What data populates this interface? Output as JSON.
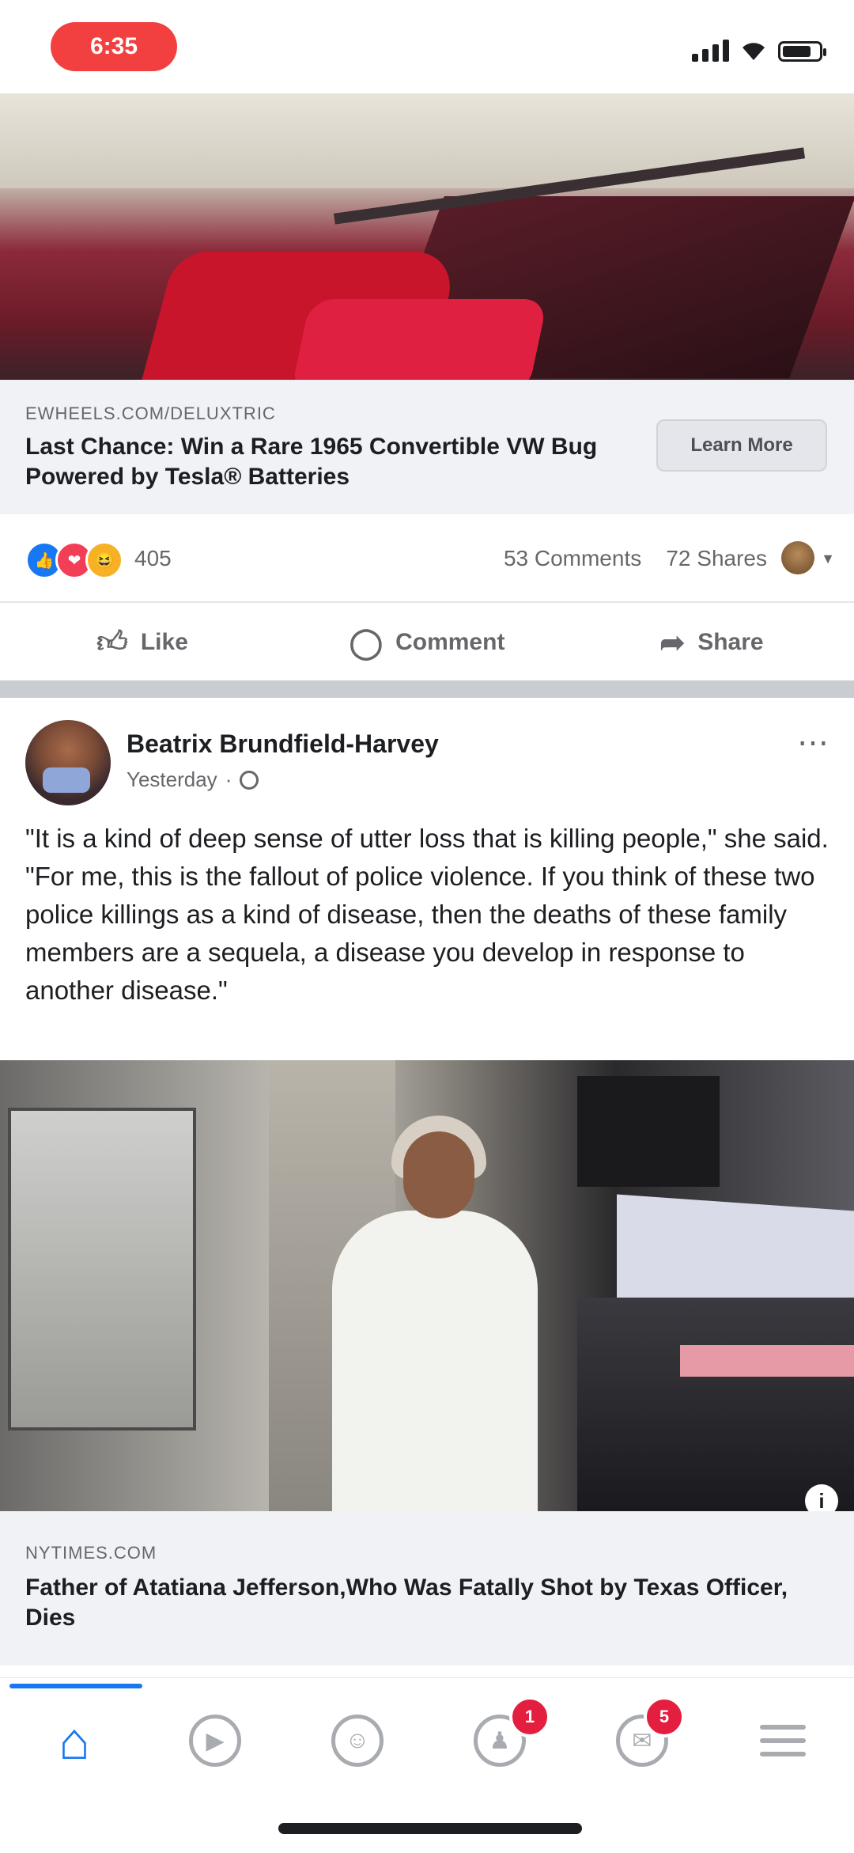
{
  "status_bar": {
    "time": "6:35"
  },
  "post1": {
    "link": {
      "domain": "EWHEELS.COM/DELUXTRIC",
      "title": "Last Chance: Win a Rare 1965 Convertible VW Bug Powered by Tesla® Batteries",
      "button_label": "Learn More"
    },
    "reactions": {
      "count": "405"
    },
    "comments_label": "53 Comments",
    "shares_label": "72 Shares"
  },
  "actions": {
    "like": "Like",
    "comment": "Comment",
    "share": "Share"
  },
  "post2": {
    "author": "Beatrix Brundfield-Harvey",
    "time": "Yesterday",
    "text": "\"It is a kind of deep sense of utter loss that is killing people,\" she said. \"For me, this is the fallout of police violence. If you think of these two police killings as a kind of disease, then the deaths of these family members are a sequela, a disease you develop in response to another disease.\"",
    "link": {
      "domain": "NYTIMES.COM",
      "title": "Father of Atatiana Jefferson,Who Was Fatally Shot by Texas Officer, Dies"
    }
  },
  "nav": {
    "friends_badge": "1",
    "notifications_badge": "5",
    "colors": {
      "active": "#1877f2",
      "inactive": "#a8abb0",
      "badge": "#e41e3f"
    }
  }
}
